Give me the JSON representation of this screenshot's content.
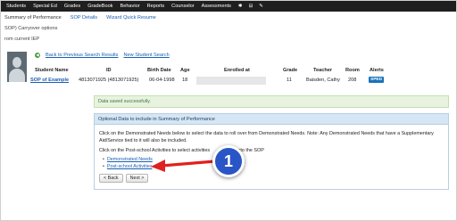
{
  "nav": {
    "items": [
      "Students",
      "Special Ed",
      "Grades",
      "GradeBook",
      "Behavior",
      "Reports",
      "Counselor",
      "Assessments"
    ],
    "icons": [
      "gear-icon",
      "table-icon",
      "wrench-icon"
    ]
  },
  "subheader": {
    "title": "Summary of Performance",
    "links": [
      "SOP Details",
      "Wizard Quick Resume"
    ],
    "carryover": "SOP) Carryover options",
    "from_iep": "rom current IEP"
  },
  "back_links": {
    "previous": "Back to Previous Search Results",
    "new_search": "New Student Search"
  },
  "student_table": {
    "headers": {
      "name": "Student Name",
      "id": "ID",
      "birth": "Birth Date",
      "age": "Age",
      "enrolled": "Enrolled at",
      "grade": "Grade",
      "teacher": "Teacher",
      "room": "Room",
      "alerts": "Alerts"
    },
    "row": {
      "name": "SOP of Example",
      "id": "4813071925 (4813071925)",
      "birth": "06-04-1998",
      "age": "18",
      "grade": "11",
      "teacher": "Baisden, Cathy",
      "room": "208",
      "alert_badge": "SPED"
    }
  },
  "alert": {
    "success": "Data saved successfully."
  },
  "panel": {
    "title": "Optional Data to include in Summary of Performance",
    "instruction_1": "Click on the Demonstrated Needs below to select the data to roll over from Demonstrated Needs. Note: Any Demonstrated Needs that have a Supplementary Aid/Service tied to it will also be included.",
    "instruction_2_start": "Click on the Post-school Activities to select activities",
    "instruction_2_end": "into the SOP",
    "options": [
      "Demonstrated Needs",
      "Post-school Activities"
    ],
    "buttons": {
      "back": "< Back",
      "next": "Next >"
    }
  },
  "annotation": {
    "callout_number": "1",
    "callout_color": "#2a55c7",
    "arrow_color": "#e02020"
  },
  "colors": {
    "nav_bg": "#1f1f1f",
    "link": "#1a5fb4",
    "success_bg": "#e8f3df",
    "panel_head_bg": "#d5e6f4",
    "badge": "#1a73b8"
  }
}
